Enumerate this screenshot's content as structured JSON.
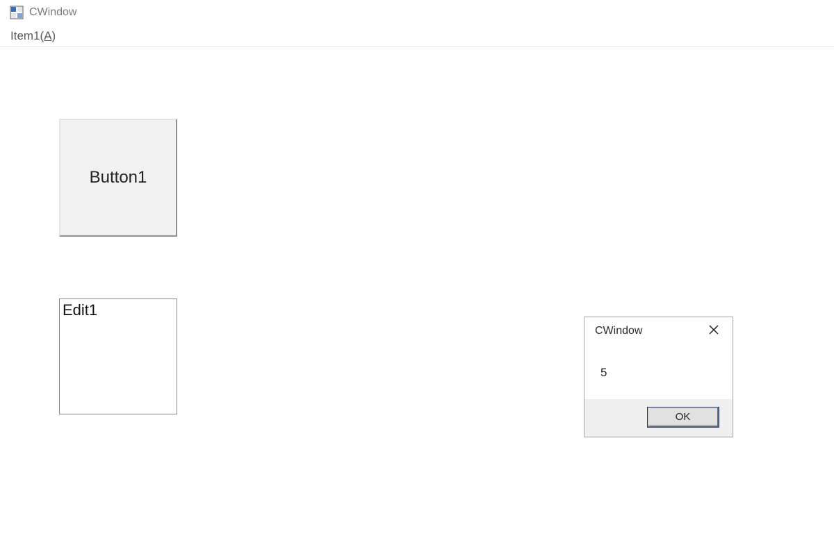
{
  "window": {
    "title": "CWindow"
  },
  "menubar": {
    "items": [
      {
        "label_pre": "Item1(",
        "accel": "A",
        "label_post": ")"
      }
    ]
  },
  "main": {
    "button1_label": "Button1",
    "edit1_value": "Edit1"
  },
  "dialog": {
    "title": "CWindow",
    "message": "5",
    "ok_label": "OK"
  }
}
